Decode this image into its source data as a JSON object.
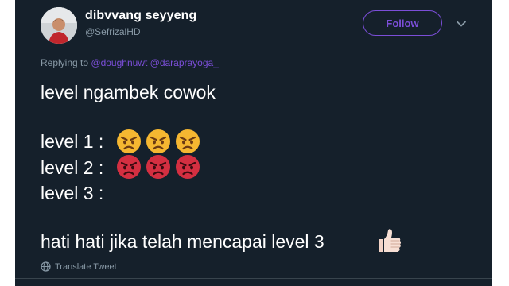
{
  "user": {
    "display_name": "dibvvang seyyeng",
    "handle": "@SefrizalHD"
  },
  "follow_label": "Follow",
  "replying": {
    "prefix": "Replying to",
    "mention1": "@doughnuwt",
    "mention2": "@daraprayoga_"
  },
  "tweet": {
    "line1": "level ngambek cowok",
    "line2": "level 1 :",
    "line3": "level 2 :",
    "line4": "level 3 :",
    "line5": "hati hati jika telah mencapai level 3"
  },
  "emoji": {
    "level1": "angry-face",
    "level2": "pouting-face",
    "closing": "thumbs-up-light-skin"
  },
  "translate_label": "Translate Tweet",
  "colors": {
    "background": "#15202b",
    "accent": "#7b4ed8",
    "secondary_text": "#8899a6",
    "angry_yellow": "#f5b731",
    "pouting_red": "#d42f41"
  }
}
